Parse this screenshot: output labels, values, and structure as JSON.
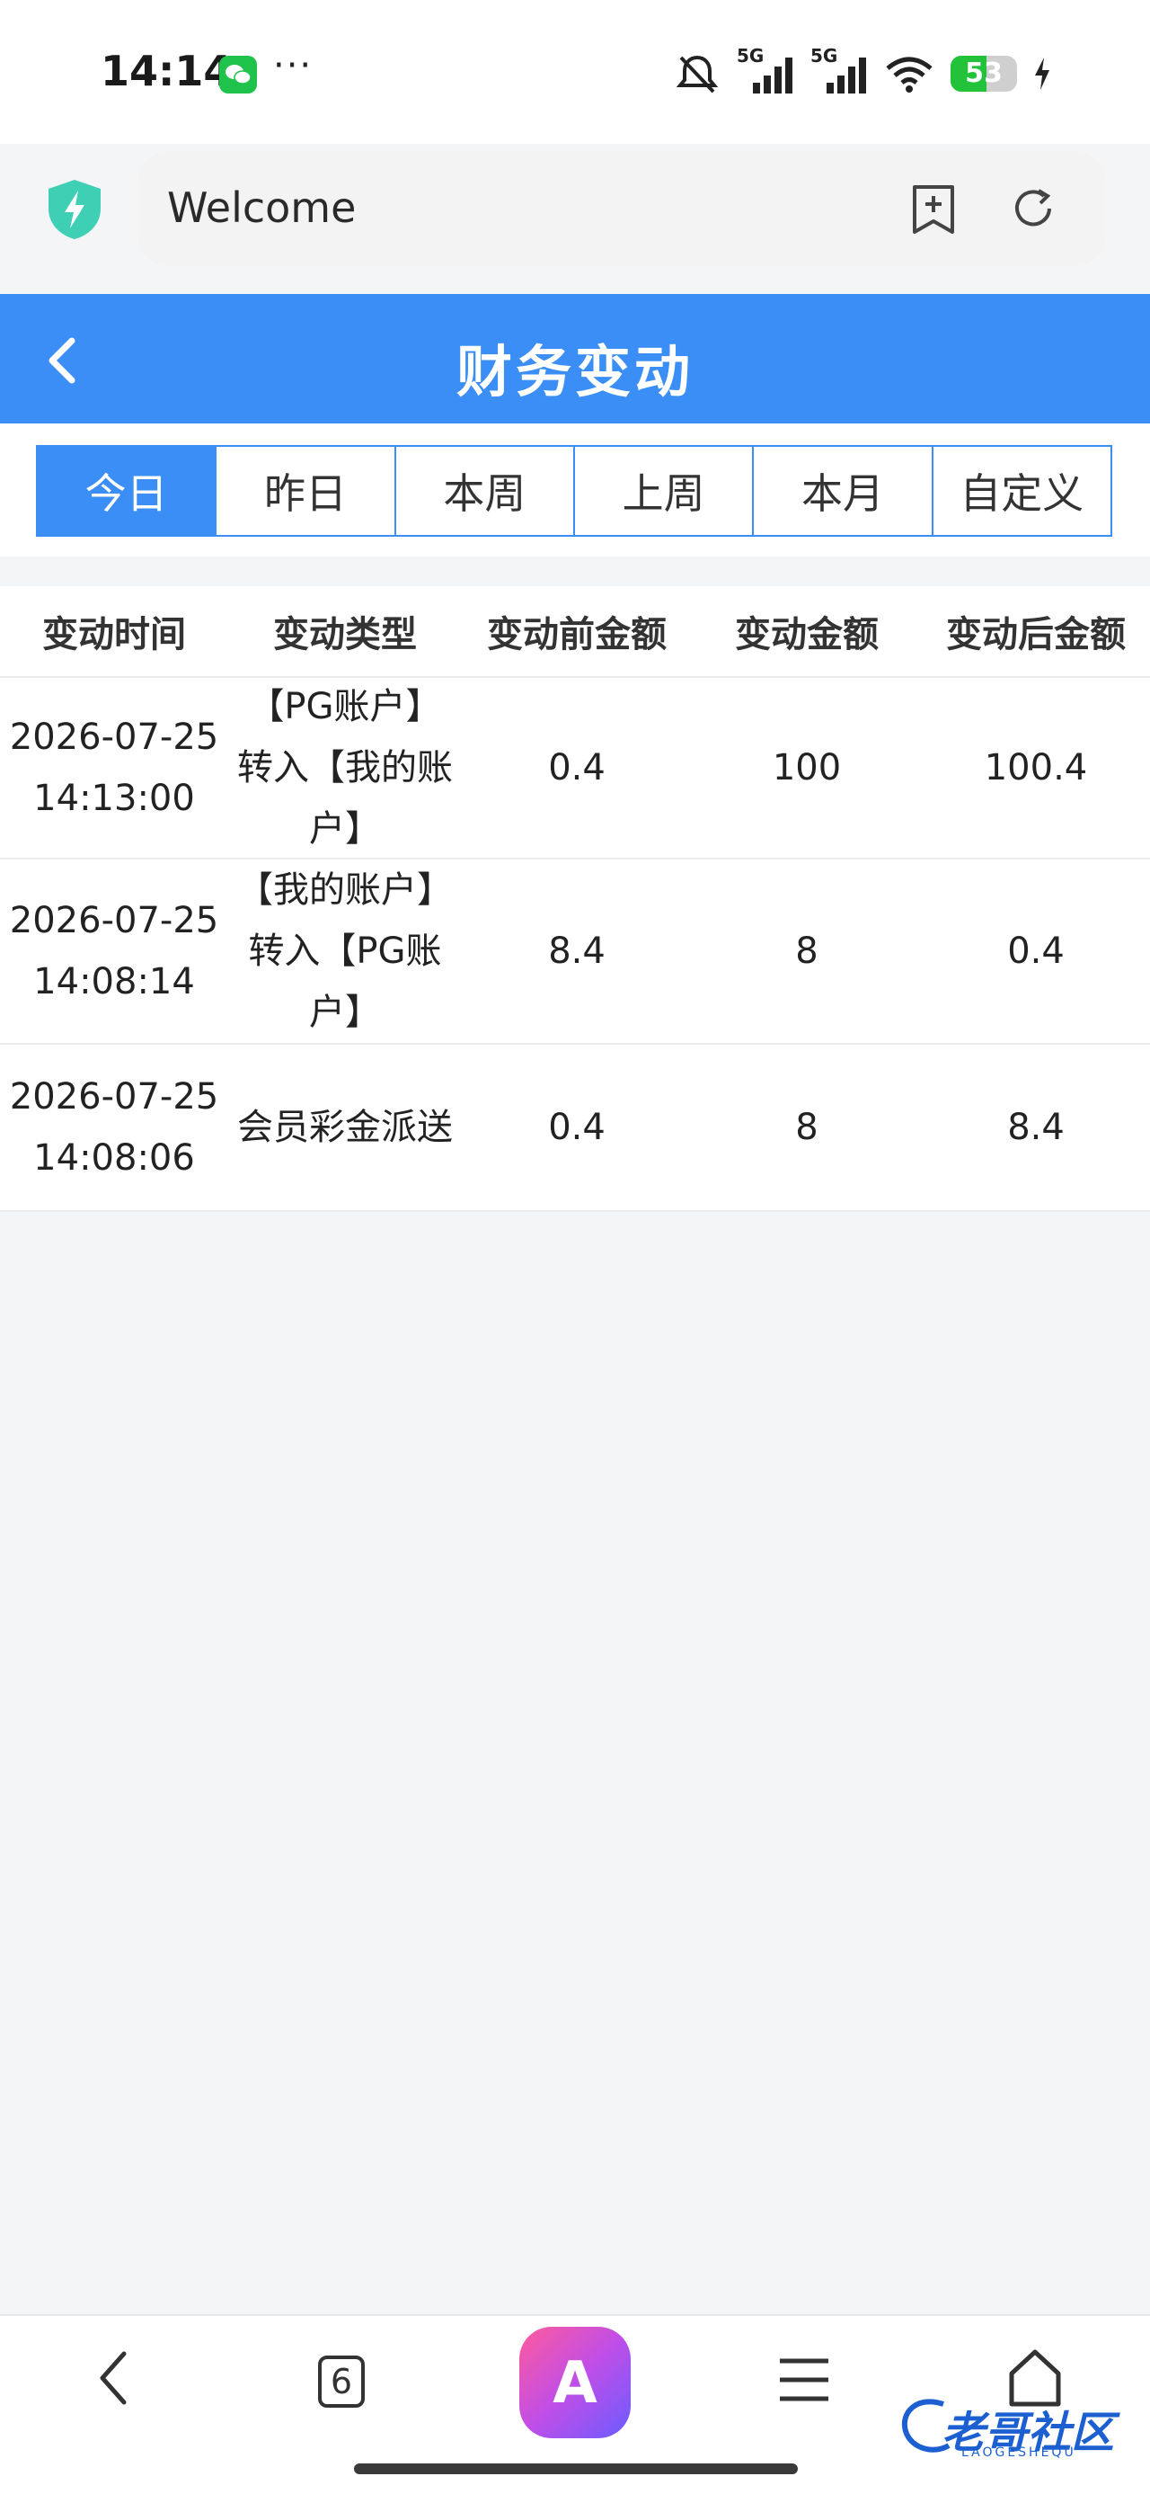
{
  "status_bar": {
    "time": "14:14",
    "network_1": "5G",
    "network_2": "5G",
    "battery": "53",
    "more": "···"
  },
  "browser": {
    "url_text": "Welcome",
    "icons": [
      "shield-bolt-icon",
      "bookmark-add-icon",
      "refresh-icon"
    ]
  },
  "header": {
    "title": "财务变动",
    "back_icon": "chevron-left-icon"
  },
  "tabs": [
    {
      "label": "今日",
      "active": true
    },
    {
      "label": "昨日",
      "active": false
    },
    {
      "label": "本周",
      "active": false
    },
    {
      "label": "上周",
      "active": false
    },
    {
      "label": "本月",
      "active": false
    },
    {
      "label": "自定义",
      "active": false
    }
  ],
  "table": {
    "headers": [
      "变动时间",
      "变动类型",
      "变动前金额",
      "变动金额",
      "变动后金额"
    ],
    "rows": [
      {
        "date": "2026-07-25",
        "time": "14:13:00",
        "type_l1": "【PG账户】",
        "type_l2": "转入【我的账",
        "type_l3": "户】",
        "before": "0.4",
        "amount": "100",
        "after": "100.4"
      },
      {
        "date": "2026-07-25",
        "time": "14:08:14",
        "type_l1": "【我的账户】",
        "type_l2": "转入【PG账",
        "type_l3": "户】",
        "before": "8.4",
        "amount": "8",
        "after": "0.4"
      },
      {
        "date": "2026-07-25",
        "time": "14:08:06",
        "type_l1": "会员彩金派送",
        "type_l2": "",
        "type_l3": "",
        "before": "0.4",
        "amount": "8",
        "after": "8.4"
      }
    ]
  },
  "bottom_nav": {
    "tab_count": "6",
    "ai_label": "A",
    "watermark": "老哥社区",
    "watermark_sub": "LAOGESHEQU"
  },
  "colors": {
    "primary": "#3a8ef5",
    "background": "#f4f5f7",
    "battery_green": "#22c33a",
    "wechat_green": "#1fc24a"
  }
}
